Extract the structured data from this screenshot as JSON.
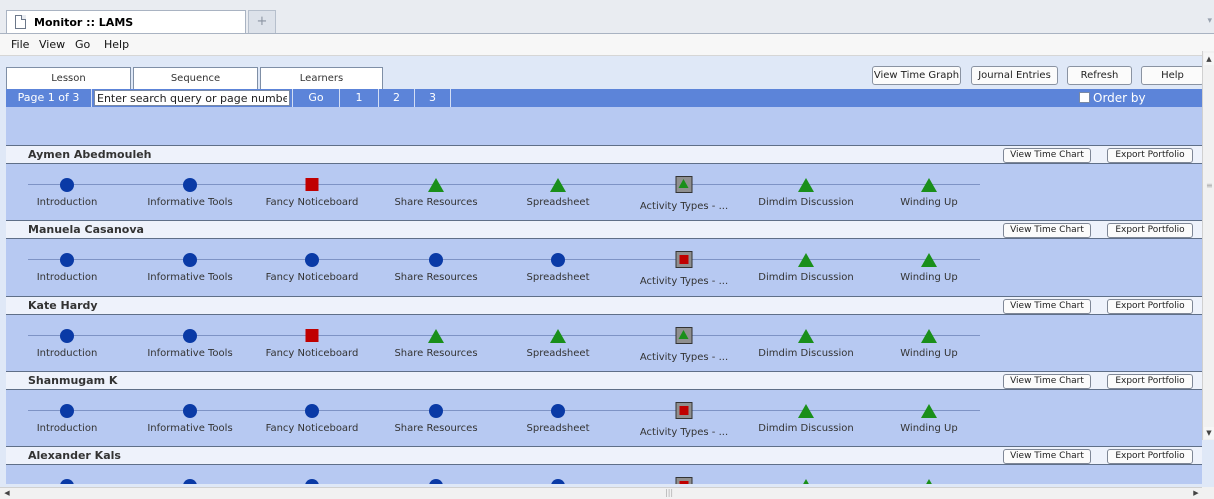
{
  "browser": {
    "tab_title": "Monitor :: LAMS",
    "new_tab_icon": "plus-icon"
  },
  "menu": [
    "File",
    "View",
    "Go",
    "Help"
  ],
  "app_tabs": [
    {
      "label": "Lesson",
      "active": false
    },
    {
      "label": "Sequence",
      "active": false
    },
    {
      "label": "Learners",
      "active": true
    }
  ],
  "toolbar": {
    "view_time_graph": "View Time Graph",
    "journal_entries": "Journal Entries",
    "refresh": "Refresh",
    "help": "Help"
  },
  "pager": {
    "page_info": "Page 1 of 3",
    "search_value": "Enter search query or page number",
    "go": "Go",
    "pages": [
      "1",
      "2",
      "3"
    ],
    "order_by_completion": "Order by completion",
    "order_checked": false
  },
  "learner_buttons": {
    "time_chart": "View Time Chart",
    "export": "Export Portfolio"
  },
  "activity_names": [
    "Introduction",
    "Informative Tools",
    "Fancy Noticeboard",
    "Share Resources",
    "Spreadsheet",
    "Activity Types - ...",
    "Dimdim Discussion",
    "Winding Up"
  ],
  "status_colors": {
    "completed": "#0a3aa6",
    "current": "#c00000",
    "not_started": "#1a8f1a"
  },
  "learners": [
    {
      "name": "Aymen Abedmouleh",
      "status": [
        "completed",
        "completed",
        "current",
        "not_started",
        "not_started",
        "boxed_not_started",
        "not_started",
        "not_started"
      ]
    },
    {
      "name": "Manuela Casanova",
      "status": [
        "completed",
        "completed",
        "completed",
        "completed",
        "completed",
        "boxed_current",
        "not_started",
        "not_started"
      ]
    },
    {
      "name": "Kate Hardy",
      "status": [
        "completed",
        "completed",
        "current",
        "not_started",
        "not_started",
        "boxed_not_started",
        "not_started",
        "not_started"
      ]
    },
    {
      "name": "Shanmugam K",
      "status": [
        "completed",
        "completed",
        "completed",
        "completed",
        "completed",
        "boxed_current",
        "not_started",
        "not_started"
      ]
    },
    {
      "name": "Alexander Kals",
      "status": [
        "completed",
        "completed",
        "completed",
        "completed",
        "completed",
        "boxed_current",
        "not_started",
        "not_started"
      ]
    }
  ]
}
